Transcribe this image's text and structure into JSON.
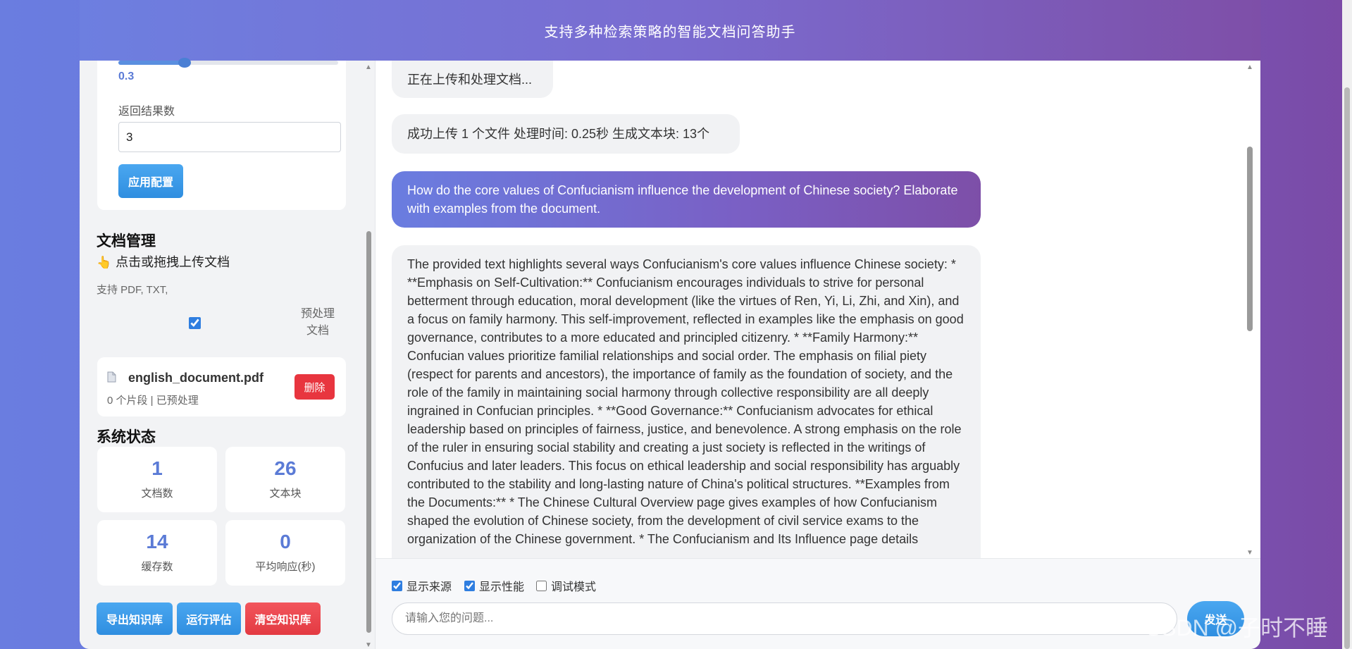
{
  "header": {
    "title": "支持多种检索策略的智能文档问答助手"
  },
  "config": {
    "threshold": 0.3,
    "threshold_label": "0.3",
    "result_count_label": "返回结果数",
    "result_count_value": "3",
    "apply_label": "应用配置"
  },
  "docs": {
    "title": "文档管理",
    "upload_hand": "👆",
    "upload_hint": "点击或拖拽上传文档",
    "support": "支持 PDF, TXT,",
    "preprocess_label": "预处理文档",
    "preprocess_checked": true,
    "file": {
      "icon": "file-icon",
      "name": "english_document.pdf",
      "meta": "0 个片段 | 已预处理",
      "delete_label": "删除"
    }
  },
  "status": {
    "title": "系统状态",
    "stats": [
      {
        "value": "1",
        "label": "文档数"
      },
      {
        "value": "26",
        "label": "文本块"
      },
      {
        "value": "14",
        "label": "缓存数"
      },
      {
        "value": "0",
        "label": "平均响应(秒)"
      }
    ]
  },
  "actions": {
    "export": "导出知识库",
    "evaluate": "运行评估",
    "clear": "清空知识库"
  },
  "chat": {
    "messages": [
      {
        "role": "system",
        "text": "正在上传和处理文档..."
      },
      {
        "role": "system",
        "text": "成功上传 1 个文件 处理时间: 0.25秒 生成文本块: 13个"
      },
      {
        "role": "user",
        "text": "How do the core values of Confucianism influence the development of Chinese society? Elaborate with examples from the document."
      },
      {
        "role": "assistant",
        "text": "The provided text highlights several ways Confucianism's core values influence Chinese society: * **Emphasis on Self-Cultivation:** Confucianism encourages individuals to strive for personal betterment through education, moral development (like the virtues of Ren, Yi, Li, Zhi, and Xin), and a focus on family harmony. This self-improvement, reflected in examples like the emphasis on good governance, contributes to a more educated and principled citizenry. * **Family Harmony:** Confucian values prioritize familial relationships and social order. The emphasis on filial piety (respect for parents and ancestors), the importance of family as the foundation of society, and the role of the family in maintaining social harmony through collective responsibility are all deeply ingrained in Confucian principles. * **Good Governance:** Confucianism advocates for ethical leadership based on principles of fairness, justice, and benevolence. A strong emphasis on the role of the ruler in ensuring social stability and creating a just society is reflected in the writings of Confucius and later leaders. This focus on ethical leadership and social responsibility has arguably contributed to the stability and long-lasting nature of China's political structures. **Examples from the Documents:** * The Chinese Cultural Overview page gives examples of how Confucianism shaped the evolution of Chinese society, from the development of civil service exams to the organization of the Chinese government. * The Confucianism and Its Influence page details"
      }
    ]
  },
  "input": {
    "show_source": "显示来源",
    "show_source_checked": true,
    "show_perf": "显示性能",
    "show_perf_checked": true,
    "debug": "调试模式",
    "debug_checked": false,
    "placeholder": "请输入您的问题...",
    "send_label": "发送"
  },
  "watermark": "CSDN @子时不睡"
}
